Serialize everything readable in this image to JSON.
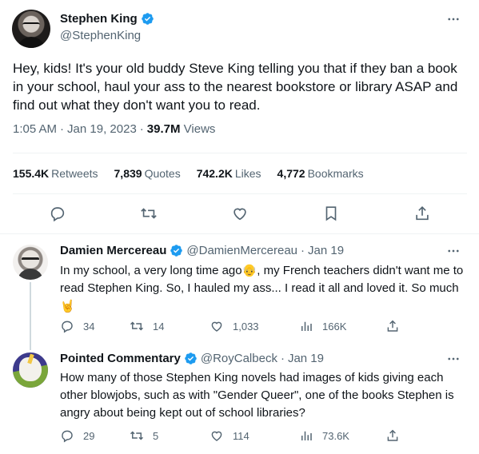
{
  "main_tweet": {
    "display_name": "Stephen King",
    "handle": "@StephenKing",
    "text": "Hey, kids! It's your old buddy Steve King telling you that if they ban a book in your school, haul your ass to the nearest bookstore or library ASAP and find out what they don't want you to read.",
    "time": "1:05 AM",
    "date": "Jan 19, 2023",
    "views_count": "39.7M",
    "views_label": "Views",
    "separator": "·",
    "stats": {
      "retweets": {
        "count": "155.4K",
        "label": "Retweets"
      },
      "quotes": {
        "count": "7,839",
        "label": "Quotes"
      },
      "likes": {
        "count": "742.2K",
        "label": "Likes"
      },
      "bookmarks": {
        "count": "4,772",
        "label": "Bookmarks"
      }
    },
    "actions": [
      "reply-icon",
      "retweet-icon",
      "like-icon",
      "bookmark-icon",
      "share-icon"
    ]
  },
  "replies": [
    {
      "display_name": "Damien Mercereau",
      "handle": "@DamienMercereau",
      "date": "Jan 19",
      "separator": "·",
      "text_part1": "In my school, a very long time ago",
      "emoji1": "👴",
      "text_part2": ", my French teachers didn't want me to read Stephen King. So, I hauled my ass... I read it all and loved it. So much",
      "emoji2": "🤘",
      "counts": {
        "replies": "34",
        "retweets": "14",
        "likes": "1,033",
        "views": "166K"
      }
    },
    {
      "display_name": "Pointed Commentary",
      "handle": "@RoyCalbeck",
      "date": "Jan 19",
      "separator": "·",
      "text": "How many of those Stephen King novels had images of kids giving each other blowjobs, such as with \"Gender Queer\", one of the books Stephen is angry about being kept out of school libraries?",
      "counts": {
        "replies": "29",
        "retweets": "5",
        "likes": "114",
        "views": "73.6K"
      }
    }
  ],
  "colors": {
    "verified": "#1d9bf0",
    "text_secondary": "#536471",
    "text_primary": "#0f1419",
    "divider": "#eff3f4"
  }
}
